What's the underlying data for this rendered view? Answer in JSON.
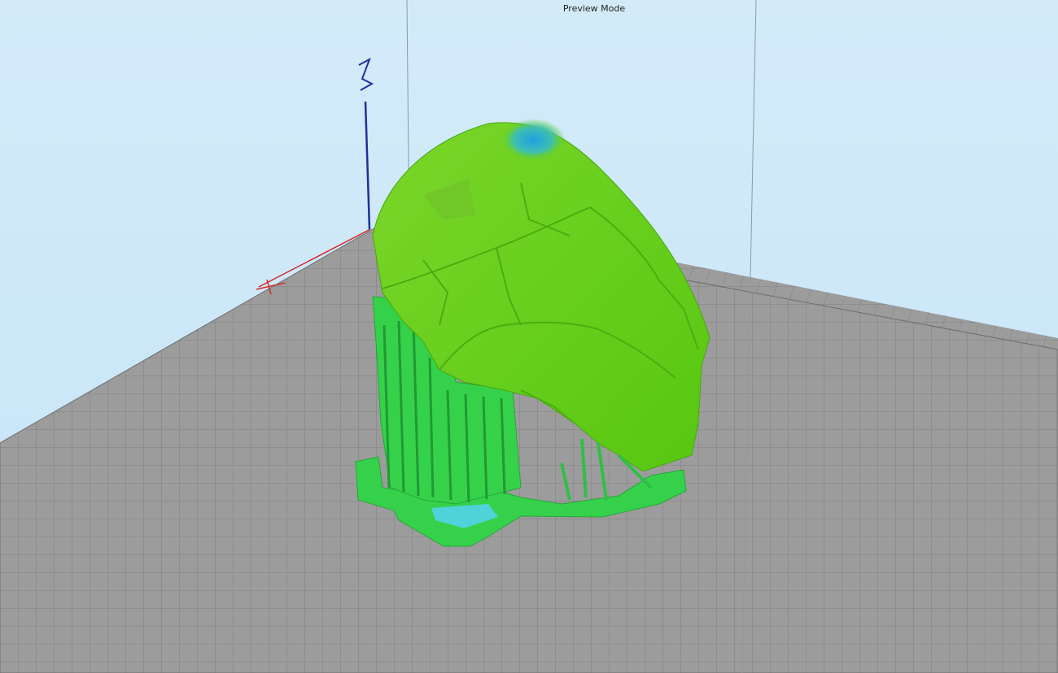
{
  "viewport": {
    "mode_label": "Preview Mode",
    "axis_z_label": "Z"
  },
  "colors": {
    "background": "#cfe8f7",
    "bed": "#9c9c9c",
    "bed_grid": "#7f7f7f",
    "axis_x": "#d42a2a",
    "axis_z": "#1f2f9c",
    "model_top": "#63cf1a",
    "model_support": "#36d14a",
    "model_highlight": "#2aa6d8"
  },
  "icons": {
    "axis_x": "x-axis-icon",
    "axis_z": "z-axis-icon"
  }
}
